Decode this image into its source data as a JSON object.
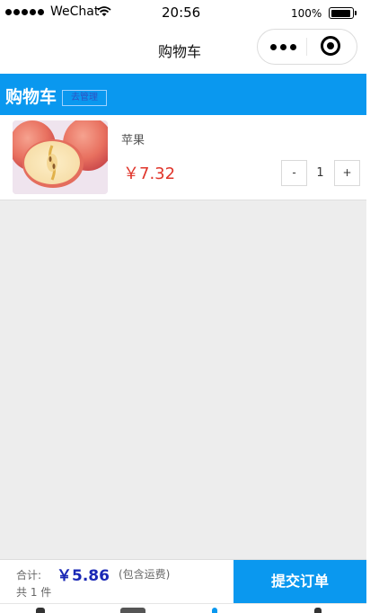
{
  "status_bar": {
    "carrier": "WeChat",
    "time": "20:56",
    "battery_percent": "100%"
  },
  "nav": {
    "title": "购物车",
    "more_icon": "ellipsis-icon",
    "close_icon": "target-close-icon"
  },
  "header": {
    "title": "购物车",
    "manage_label": "去管理",
    "background_color": "#0a98ef"
  },
  "cart": {
    "items": [
      {
        "name": "苹果",
        "price": "￥7.32",
        "quantity": "1",
        "minus_label": "-",
        "plus_label": "+",
        "image_icon": "apple-photo"
      }
    ]
  },
  "footer": {
    "total_label": "合计:",
    "total_amount": "￥5.86",
    "shipping_note": "(包含运费)",
    "count_text": "共 1 件",
    "submit_label": "提交订单",
    "price_color": "#e0352b",
    "total_color": "#1a28b5"
  }
}
